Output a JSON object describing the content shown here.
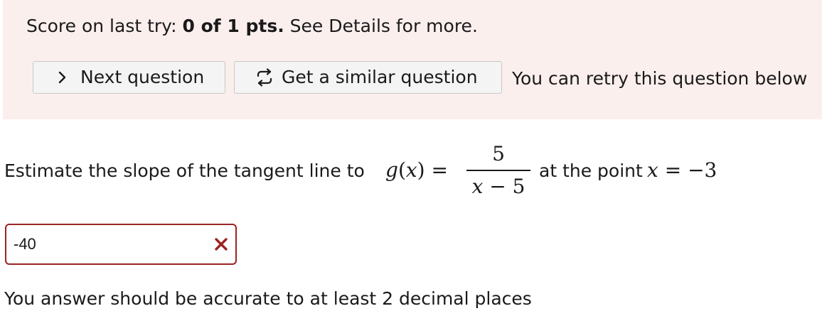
{
  "score": {
    "prefix": "Score on last try: ",
    "value": "0 of 1 pts.",
    "suffix": " See Details for more."
  },
  "buttons": {
    "next_label": "Next question",
    "next_icon": "chevron-right-icon",
    "similar_label": "Get a similar question",
    "similar_icon": "retry-arrows-icon"
  },
  "retry_text": "You can retry this question below",
  "question": {
    "prefix": "Estimate the slope of the tangent line to",
    "function_name": "g",
    "function_var": "x",
    "equals": "=",
    "numerator": "5",
    "denominator_var": "x",
    "denominator_rest": " − 5",
    "suffix": "at the point",
    "point_var": "x",
    "point_value": "= −3"
  },
  "answer": {
    "value": "-40",
    "status": "incorrect",
    "status_color": "#9b2323"
  },
  "cutoff_text": "You answer should be accurate to at least 2 decimal places"
}
